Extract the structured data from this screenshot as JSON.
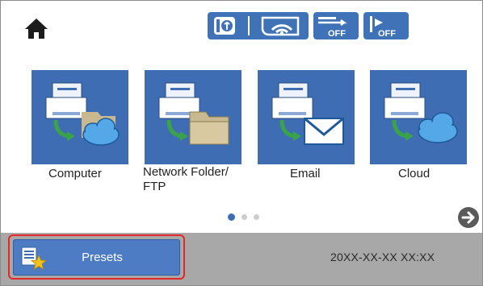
{
  "header": {
    "home_icon": "home-icon",
    "status_icons": [
      "info-icon",
      "wifi-icon",
      "feed-off-icon",
      "direct-off-icon"
    ],
    "off_label_1": "OFF",
    "off_label_2": "OFF"
  },
  "tiles": [
    {
      "label": "Computer",
      "icon": "scan-to-computer-icon"
    },
    {
      "label": "Network Folder/\nFTP",
      "icon": "scan-to-folder-icon"
    },
    {
      "label": "Email",
      "icon": "scan-to-email-icon"
    },
    {
      "label": "Cloud",
      "icon": "scan-to-cloud-icon"
    }
  ],
  "pager": {
    "pages": 3,
    "current": 1
  },
  "footer": {
    "presets_label": "Presets",
    "datetime": "20XX-XX-XX XX:XX"
  },
  "colors": {
    "tile_blue": "#3e6db3",
    "status_blue": "#3f72b6",
    "bar_gray": "#a8a8a8",
    "highlight_red": "#e42826"
  }
}
